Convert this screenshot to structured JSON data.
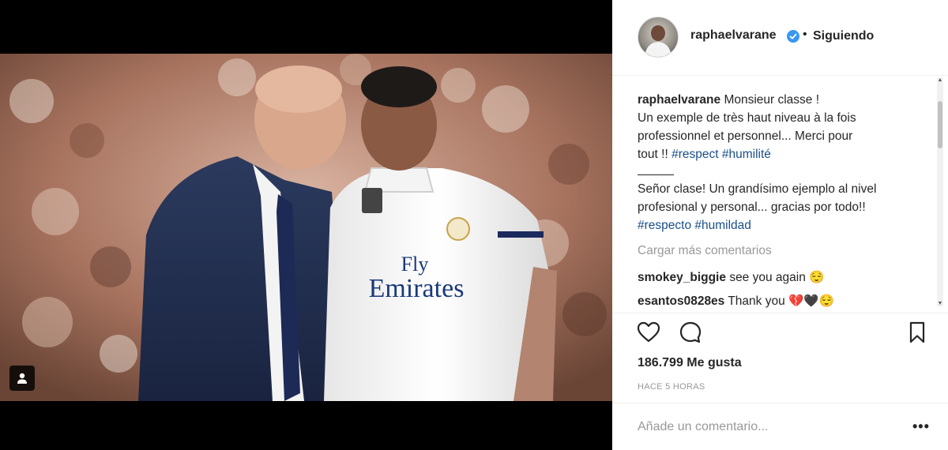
{
  "post": {
    "username": "raphaelvarane",
    "separator": "•",
    "follow_state": "Siguiendo",
    "caption_user": "raphaelvarane",
    "caption_lines": [
      "Monsieur classe !",
      "Un exemple de très haut niveau à la fois",
      "professionnel et personnel... Merci pour",
      "tout !!"
    ],
    "caption_tags_fr": [
      "#respect",
      "#humilité"
    ],
    "caption_es_lines": [
      "Señor clase! Un grandísimo ejemplo al nivel",
      "profesional y personal... gracias por todo!!"
    ],
    "caption_tags_es": [
      "#respecto",
      "#humildad"
    ],
    "load_more": "Cargar más comentarios",
    "comments": [
      {
        "user": "smokey_biggie",
        "text": "see you again 😌"
      },
      {
        "user": "esantos0828es",
        "text": "Thank you 💔🖤😌"
      }
    ],
    "likes": "186.799 Me gusta",
    "time": "HACE 5 HORAS",
    "add_comment_placeholder": "Añade un comentario...",
    "more": "•••"
  },
  "photo": {
    "jersey_sponsor_1": "Fly",
    "jersey_sponsor_2": "Emirates"
  },
  "icons": {
    "like": "heart-icon",
    "comment": "comment-icon",
    "save": "bookmark-icon",
    "tag": "user-tag-icon",
    "verified": "verified-badge-icon"
  },
  "colors": {
    "verified": "#3897f0",
    "hashtag": "#1a4f8a",
    "muted": "#999999"
  }
}
